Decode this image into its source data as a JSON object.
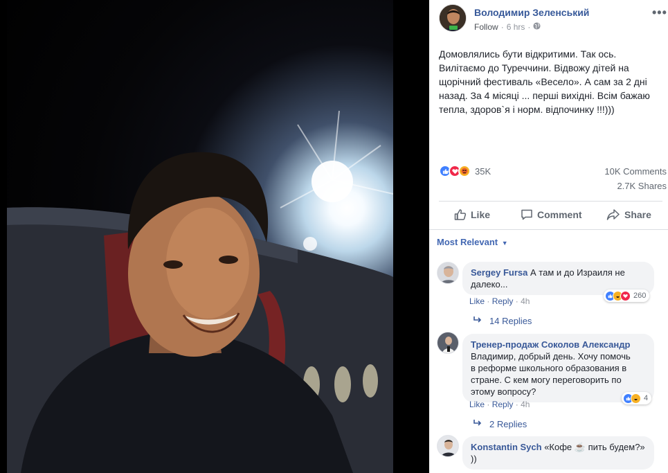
{
  "post": {
    "author": "Володимир Зеленський",
    "follow": "Follow",
    "time": "6 hrs",
    "text": "Домовлялись бути відкритими. Так ось. Вилітаємо до Туреччини. Відвожу дітей на щорічний фестиваль «Весело». А сам за 2 дні назад. За 4 місяці ... перші вихідні. Всім бажаю тепла, здоров`я і норм. відпочинку !!!)))",
    "reactions_count": "35K",
    "comments_count": "10K Comments",
    "shares_count": "2.7K Shares",
    "actions": {
      "like": "Like",
      "comment": "Comment",
      "share": "Share"
    },
    "sort": "Most Relevant",
    "more": "•••"
  },
  "comments": [
    {
      "name": "Sergey Fursa",
      "text": "А там и до Израиля не далеко...",
      "like": "Like",
      "reply": "Reply",
      "time": "4h",
      "reactions": "260",
      "replies": "14 Replies"
    },
    {
      "name": "Тренер-продаж Соколов Александр",
      "text": "Владимир, добрый день. Хочу помочь в реформе школьного образования в стране. С кем могу переговорить по этому вопросу?",
      "like": "Like",
      "reply": "Reply",
      "time": "4h",
      "reactions": "4",
      "replies": "2 Replies"
    },
    {
      "name": "Konstantin Sych",
      "text": "«Кофе ☕ пить будем?» ))"
    }
  ],
  "colors": {
    "link": "#365899",
    "brand": "#4267b2",
    "like": "#4080ff",
    "love": "#f0284a",
    "angry": "#f7b125"
  }
}
